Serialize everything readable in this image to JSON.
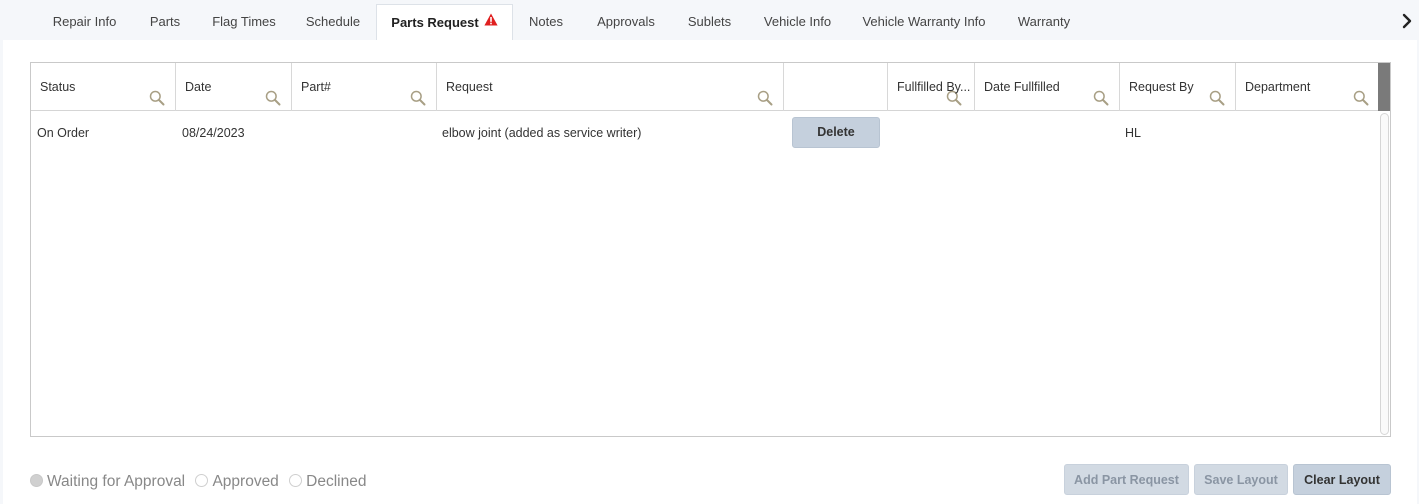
{
  "tabs": [
    {
      "label": "Repair Info",
      "active": false
    },
    {
      "label": "Parts",
      "active": false
    },
    {
      "label": "Flag Times",
      "active": false
    },
    {
      "label": "Schedule",
      "active": false
    },
    {
      "label": "Parts Request",
      "active": true,
      "warning": true
    },
    {
      "label": "Notes",
      "active": false
    },
    {
      "label": "Approvals",
      "active": false
    },
    {
      "label": "Sublets",
      "active": false
    },
    {
      "label": "Vehicle Info",
      "active": false
    },
    {
      "label": "Vehicle Warranty Info",
      "active": false
    },
    {
      "label": "Warranty",
      "active": false
    }
  ],
  "grid": {
    "columns": [
      {
        "label": "Status",
        "searchable": true
      },
      {
        "label": "Date",
        "searchable": true
      },
      {
        "label": "Part#",
        "searchable": true
      },
      {
        "label": "Request",
        "searchable": true
      },
      {
        "label": "",
        "searchable": false
      },
      {
        "label": "Fullfilled By...",
        "searchable": true
      },
      {
        "label": "Date Fullfilled",
        "searchable": true
      },
      {
        "label": "Request By",
        "searchable": true
      },
      {
        "label": "Department",
        "searchable": true
      }
    ],
    "rows": [
      {
        "status": "On Order",
        "date": "08/24/2023",
        "part_no": "",
        "request": "elbow joint (added as service writer)",
        "action_label": "Delete",
        "fulfilled_by": "",
        "date_fulfilled": "",
        "request_by": "HL",
        "department": ""
      }
    ]
  },
  "legend": [
    {
      "label": "Waiting for Approval",
      "state": "filled"
    },
    {
      "label": "Approved",
      "state": "empty"
    },
    {
      "label": "Declined",
      "state": "empty"
    }
  ],
  "actions": {
    "add_part_request": "Add Part Request",
    "save_layout": "Save Layout",
    "clear_layout": "Clear Layout"
  },
  "colors": {
    "warning": "#e02020",
    "search_icon": "#a89f85",
    "button_bg": "#c5d0dd",
    "disabled_text": "#8a95a3"
  }
}
